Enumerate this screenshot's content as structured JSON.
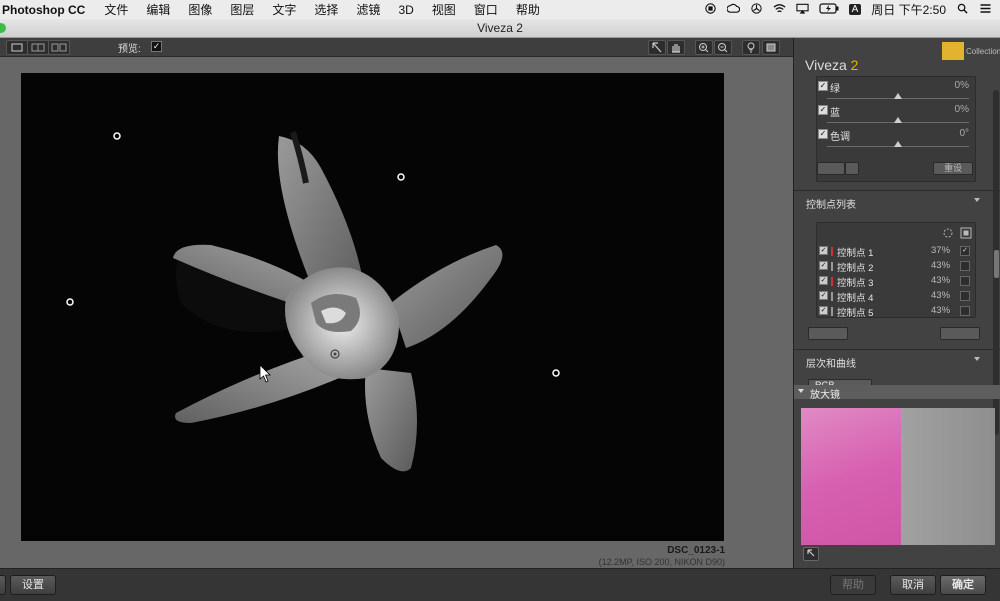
{
  "menubar": {
    "app_name": "Photoshop CC",
    "items": [
      "文件",
      "编辑",
      "图像",
      "图层",
      "文字",
      "选择",
      "滤镜",
      "3D",
      "视图",
      "窗口",
      "帮助"
    ],
    "clock": "周日 下午2:50",
    "input_method": "A"
  },
  "window": {
    "title": "Viveza 2"
  },
  "toolbar": {
    "preview_label": "预览:",
    "preview_checked": "✓"
  },
  "canvas": {
    "file_name": "DSC_0123-1",
    "file_meta": "(12.2MP, ISO 200, NIKON D90)"
  },
  "panel": {
    "brand_name": "Viveza",
    "brand_version": "2",
    "collection_text": "Collection",
    "sliders": [
      {
        "label": "绿",
        "value": "0%",
        "checked": "✓"
      },
      {
        "label": "蓝",
        "value": "0%",
        "checked": "✓"
      },
      {
        "label": "色调",
        "value": "0°",
        "checked": "✓"
      }
    ],
    "reset_label": "重设",
    "control_points_header": "控制点列表",
    "control_points": [
      {
        "label": "控制点 1",
        "value": "37%",
        "checked": "✓",
        "selected": "✓"
      },
      {
        "label": "控制点 2",
        "value": "43%",
        "checked": "✓",
        "selected": ""
      },
      {
        "label": "控制点 3",
        "value": "43%",
        "checked": "✓",
        "selected": ""
      },
      {
        "label": "控制点 4",
        "value": "43%",
        "checked": "✓",
        "selected": ""
      },
      {
        "label": "控制点 5",
        "value": "43%",
        "checked": "✓",
        "selected": ""
      }
    ],
    "curves_header": "层次和曲线",
    "channel_select": "RGB",
    "loupe_header": "放大镜"
  },
  "bottombar": {
    "settings_label": "设置",
    "save_label": "帮助",
    "cancel_label": "取消",
    "ok_label": "确定"
  },
  "colors": {
    "accent": "#e4b400",
    "photo_bg": "#050505",
    "panel_bg": "#424242"
  }
}
